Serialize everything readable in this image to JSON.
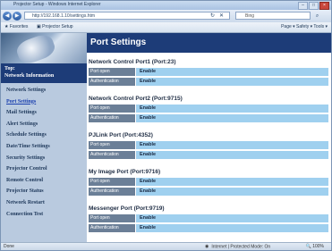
{
  "browser": {
    "title": "Projector Setup - Windows Internet Explorer",
    "address": "http://192.168.1.10/settings.htm",
    "search_placeholder": "Bing",
    "favorites_label": "Favorites",
    "favorite_tab": "Projector Setup",
    "command_bar": "Page ▾  Safety ▾  Tools ▾",
    "status_left": "Done",
    "status_zone": "Internet | Protected Mode: On",
    "zoom": "100%"
  },
  "sidebar": {
    "top_line1": "Top:",
    "top_line2": "Network Information",
    "items": [
      {
        "label": "Network Settings"
      },
      {
        "label": "Port Settings"
      },
      {
        "label": "Mail Settings"
      },
      {
        "label": "Alert Settings"
      },
      {
        "label": "Schedule Settings"
      },
      {
        "label": "Date/Time Settings"
      },
      {
        "label": "Security Settings"
      },
      {
        "label": "Projector Control"
      },
      {
        "label": "Remote Control"
      },
      {
        "label": "Projector Status"
      },
      {
        "label": "Network Restart"
      },
      {
        "label": "Connection Test"
      }
    ]
  },
  "main": {
    "title": "Port Settings",
    "sections": [
      {
        "title": "Network Control Port1 (Port:23)",
        "rows": [
          {
            "key": "Port open",
            "value": "Enable"
          },
          {
            "key": "Authentication",
            "value": "Enable"
          }
        ]
      },
      {
        "title": "Network Control Port2 (Port:9715)",
        "rows": [
          {
            "key": "Port open",
            "value": "Enable"
          },
          {
            "key": "Authentication",
            "value": "Enable"
          }
        ]
      },
      {
        "title": "PJLink Port (Port:4352)",
        "rows": [
          {
            "key": "Port open",
            "value": "Enable"
          },
          {
            "key": "Authentication",
            "value": "Enable"
          }
        ]
      },
      {
        "title": "My Image Port (Port:9716)",
        "rows": [
          {
            "key": "Port open",
            "value": "Enable"
          },
          {
            "key": "Authentication",
            "value": "Enable"
          }
        ]
      },
      {
        "title": "Messenger Port (Port:9719)",
        "rows": [
          {
            "key": "Port open",
            "value": "Enable"
          },
          {
            "key": "Authentication",
            "value": "Enable"
          }
        ]
      }
    ]
  }
}
